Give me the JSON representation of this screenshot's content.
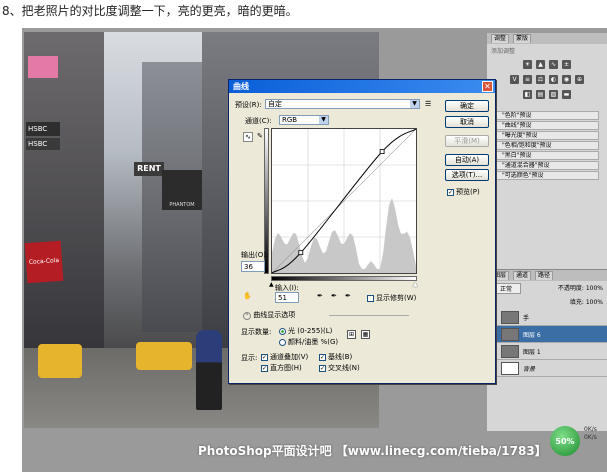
{
  "caption": "8、把老照片的对比度调整一下，亮的更亮，暗的更暗。",
  "watermark": "PhotoShop平面设计吧 【www.linecg.com/tieba/1783】",
  "badge": {
    "percent": "50%",
    "rate1": "0K/s",
    "rate2": "0K/s"
  },
  "photo_signs": {
    "hsbc1": "HSBC",
    "hsbc2": "HSBC",
    "rent": "RENT",
    "phantom": "PHANTOM",
    "coke": "Coca-Cola"
  },
  "dialog": {
    "title": "曲线",
    "preset_label": "预设(R):",
    "preset_value": "自定",
    "channel_label": "通道(C):",
    "channel_value": "RGB",
    "buttons": {
      "ok": "确定",
      "cancel": "取消",
      "smooth": "平滑(M)",
      "auto": "自动(A)",
      "options": "选项(T)...",
      "preview": "预览(P)"
    },
    "output_label": "输出(O):",
    "output_value": "36",
    "input_label": "输入(I):",
    "input_value": "51",
    "show_clipping": "显示修剪(W)",
    "curve_display_options": "曲线显示选项",
    "show_amount": "显示数量:",
    "light_option": "光 (0-255)(L)",
    "pigment_option": "颜料/油墨 %(G)",
    "show": "显示:",
    "channel_overlay": "通道叠加(V)",
    "baseline": "基线(B)",
    "histogram": "直方图(H)",
    "intersection_line": "交叉线(N)"
  },
  "curve_points": [
    [
      0,
      0
    ],
    [
      51,
      36
    ],
    [
      195,
      215
    ],
    [
      255,
      255
    ]
  ],
  "adjustments_panel": {
    "tabs": [
      "调整",
      "蒙版"
    ],
    "title": "添加调整",
    "presets": [
      "\"色阶\"预设",
      "\"曲线\"预设",
      "\"曝光度\"预设",
      "\"色相/饱和度\"预设",
      "\"黑白\"预设",
      "\"通道混合器\"预设",
      "\"可选颜色\"预设"
    ]
  },
  "layers_panel": {
    "tabs": [
      "图层",
      "通道",
      "路径"
    ],
    "blend_mode": "正常",
    "opacity": "不透明度: 100%",
    "fill": "填充: 100%",
    "layers": [
      {
        "name": "手",
        "selected": false
      },
      {
        "name": "图层 6",
        "selected": true
      },
      {
        "name": "图层 1",
        "selected": false
      },
      {
        "name": "背景",
        "selected": false
      }
    ]
  }
}
